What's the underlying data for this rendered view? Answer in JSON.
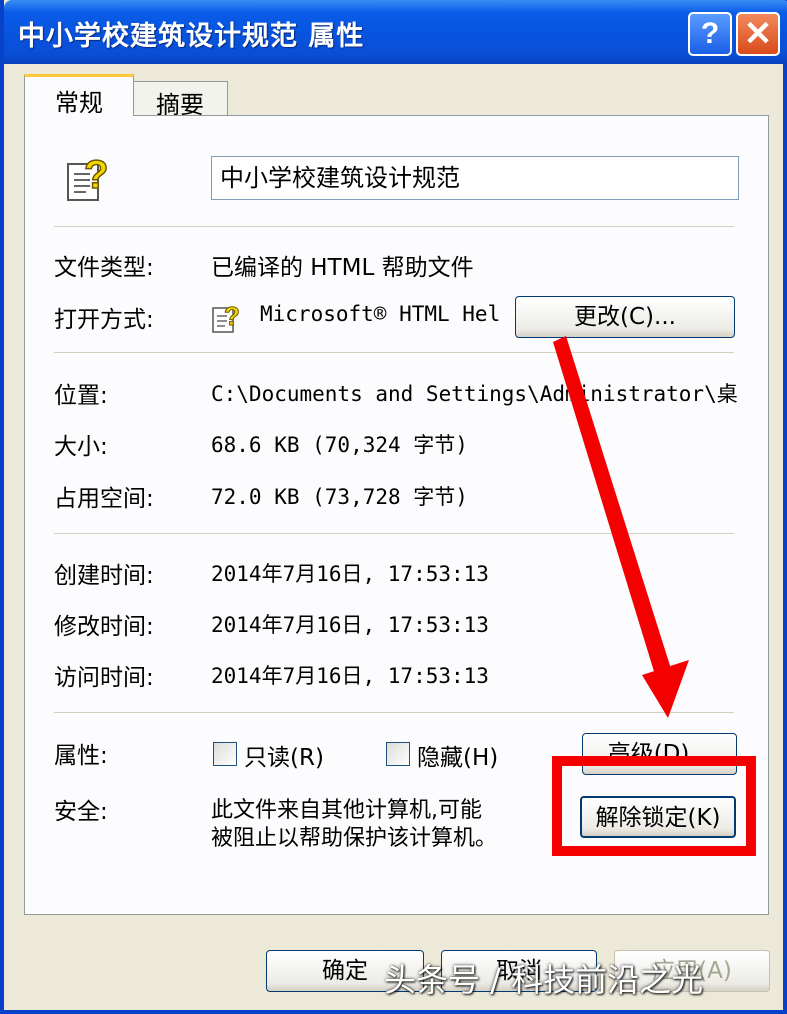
{
  "window": {
    "title": "中小学校建筑设计规范 属性",
    "help_button": "?",
    "close_button": "✕"
  },
  "tabs": [
    {
      "label": "常规",
      "active": true
    },
    {
      "label": "摘要",
      "active": false
    }
  ],
  "file": {
    "icon": "help-file-icon",
    "name": "中小学校建筑设计规范"
  },
  "details": {
    "type_label": "文件类型:",
    "type_value": "已编译的 HTML 帮助文件",
    "opens_label": "打开方式:",
    "opens_value": "Microsoft® HTML Hel",
    "change_button": "更改(C)...",
    "location_label": "位置:",
    "location_value": "C:\\Documents and Settings\\Administrator\\桌",
    "size_label": "大小:",
    "size_value": "68.6 KB (70,324 字节)",
    "disk_label": "占用空间:",
    "disk_value": "72.0 KB (73,728 字节)",
    "created_label": "创建时间:",
    "created_value": "2014年7月16日, 17:53:13",
    "modified_label": "修改时间:",
    "modified_value": "2014年7月16日, 17:53:13",
    "accessed_label": "访问时间:",
    "accessed_value": "2014年7月16日, 17:53:13"
  },
  "attributes": {
    "label": "属性:",
    "readonly_label": "只读(R)",
    "readonly_checked": false,
    "hidden_label": "隐藏(H)",
    "hidden_checked": false,
    "advanced_button": "高级(D)..."
  },
  "security": {
    "label": "安全:",
    "message_line1": "此文件来自其他计算机,可能",
    "message_line2": "被阻止以帮助保护该计算机。",
    "unblock_button": "解除锁定(K)"
  },
  "footer": {
    "ok_button": "确定",
    "cancel_button": "取消",
    "apply_button": "应用(A)"
  },
  "watermark": "头条号 / 科技前沿之光",
  "colors": {
    "titlebar": "#0a5ce8",
    "highlight_box": "#f40000",
    "arrow": "#f40000"
  }
}
